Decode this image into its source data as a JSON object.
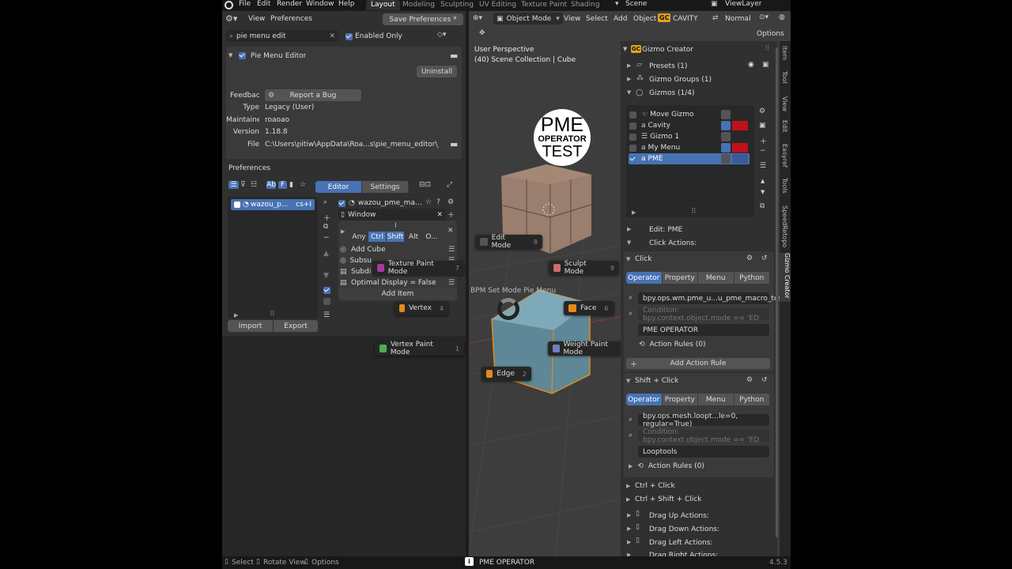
{
  "topbar": {
    "menus": [
      "File",
      "Edit",
      "Render",
      "Window",
      "Help"
    ],
    "workspaces": [
      "Layout",
      "Modeling",
      "Sculpting",
      "UV Editing",
      "Texture Paint",
      "Shading"
    ],
    "active_workspace": "Layout",
    "scene": "Scene",
    "view_layer": "ViewLayer"
  },
  "prefs": {
    "header": {
      "view": "View",
      "preferences": "Preferences",
      "save": "Save Preferences *"
    },
    "search": {
      "value": "pie menu edit",
      "enabled_only": "Enabled Only"
    },
    "addon": {
      "name": "Pie Menu Editor",
      "uninstall": "Uninstall",
      "labels": [
        "Feedback",
        "Type",
        "Maintainer",
        "Version",
        "File"
      ],
      "report": "Report a Bug",
      "type": "Legacy (User)",
      "maintainer": "roaoao",
      "version": "1.18.8",
      "file": "C:\\Users\\pitiw\\AppData\\Roa...s\\pie_menu_editor\\__init__.py"
    },
    "preferences_label": "Preferences",
    "tabs": {
      "editor": "Editor",
      "settings": "Settings"
    },
    "menu_item": {
      "name": "wazou_p...",
      "hotkey": "cs+I"
    },
    "menu_header": "wazou_pme_ma...",
    "window": "Window",
    "keys": [
      "Any",
      "Ctrl",
      "Shift",
      "Alt",
      "O..."
    ],
    "items": [
      "Add Cube",
      "Subsu",
      "Subdi",
      "Optimal Display = False"
    ],
    "add_item": "Add Item",
    "import": "Import",
    "export": "Export"
  },
  "viewport": {
    "header": {
      "mode": "Object Mode",
      "menus": [
        "View",
        "Select",
        "Add",
        "Object"
      ],
      "gc": "GC",
      "cavity": "CAVITY",
      "orient": "Normal",
      "options": "Options"
    },
    "overlay": [
      "User Perspective",
      "(40) Scene Collection | Cube"
    ],
    "watermark": [
      "PME",
      "OPERATOR",
      "TEST"
    ],
    "pie_label": "BPM Set Mode Pie Menu",
    "pie": [
      {
        "label": "Edit Mode",
        "key": "8"
      },
      {
        "label": "Sculpt Mode",
        "key": "9"
      },
      {
        "label": "Texture Paint Mode",
        "key": "7"
      },
      {
        "label": "Face",
        "key": "6"
      },
      {
        "label": "Vertex",
        "key": "4"
      },
      {
        "label": "Vertex Paint Mode",
        "key": "1"
      },
      {
        "label": "Weight Paint Mode",
        "key": "3"
      },
      {
        "label": "Edge",
        "key": "2"
      }
    ],
    "status_left": [
      "Select",
      "Rotate View",
      "Options"
    ],
    "status_center": "PME OPERATOR",
    "version": "4.5.3"
  },
  "gizmo": {
    "title": "Gizmo Creator",
    "sections": [
      "Presets (1)",
      "Gizmo Groups (1)",
      "Gizmos (1/4)"
    ],
    "list": [
      {
        "name": "Move Gizmo",
        "checked": false,
        "color": ""
      },
      {
        "name": "Cavity",
        "checked": false,
        "color": "#c0101a"
      },
      {
        "name": "Gizmo 1",
        "checked": false,
        "color": ""
      },
      {
        "name": "My Menu",
        "checked": false,
        "color": "#c0101a"
      },
      {
        "name": "PME",
        "checked": true,
        "color": "#3a5a9a"
      }
    ],
    "edit": "Edit: PME",
    "click_actions": "Click Actions:",
    "click": "Click",
    "tabs": [
      "Operator",
      "Property",
      "Menu",
      "Python"
    ],
    "op1": "bpy.ops.wm.pme_u...u_pme_macro_test')",
    "cond1": "Condition: bpy.context.object.mode == 'ED",
    "name1": "PME OPERATOR",
    "rules1": "Action Rules (0)",
    "add_rule": "Add Action Rule",
    "shift_click": "Shift + Click",
    "op2": "bpy.ops.mesh.loopt...le=0, regular=True)",
    "cond2": "Condition: bpy.context.object.mode == 'ED",
    "name2": "Looptools",
    "rules2": "Action Rules (0)",
    "more": [
      "Ctrl + Click",
      "Ctrl + Shift + Click"
    ],
    "drags": [
      "Drag Up Actions:",
      "Drag Down Actions:",
      "Drag Left Actions:",
      "Drag Right Actions:"
    ]
  },
  "side_tabs": [
    "Item",
    "Tool",
    "View",
    "Edit",
    "Easyref",
    "Tools",
    "SpeedRetopo",
    "Gizmo Creator"
  ]
}
